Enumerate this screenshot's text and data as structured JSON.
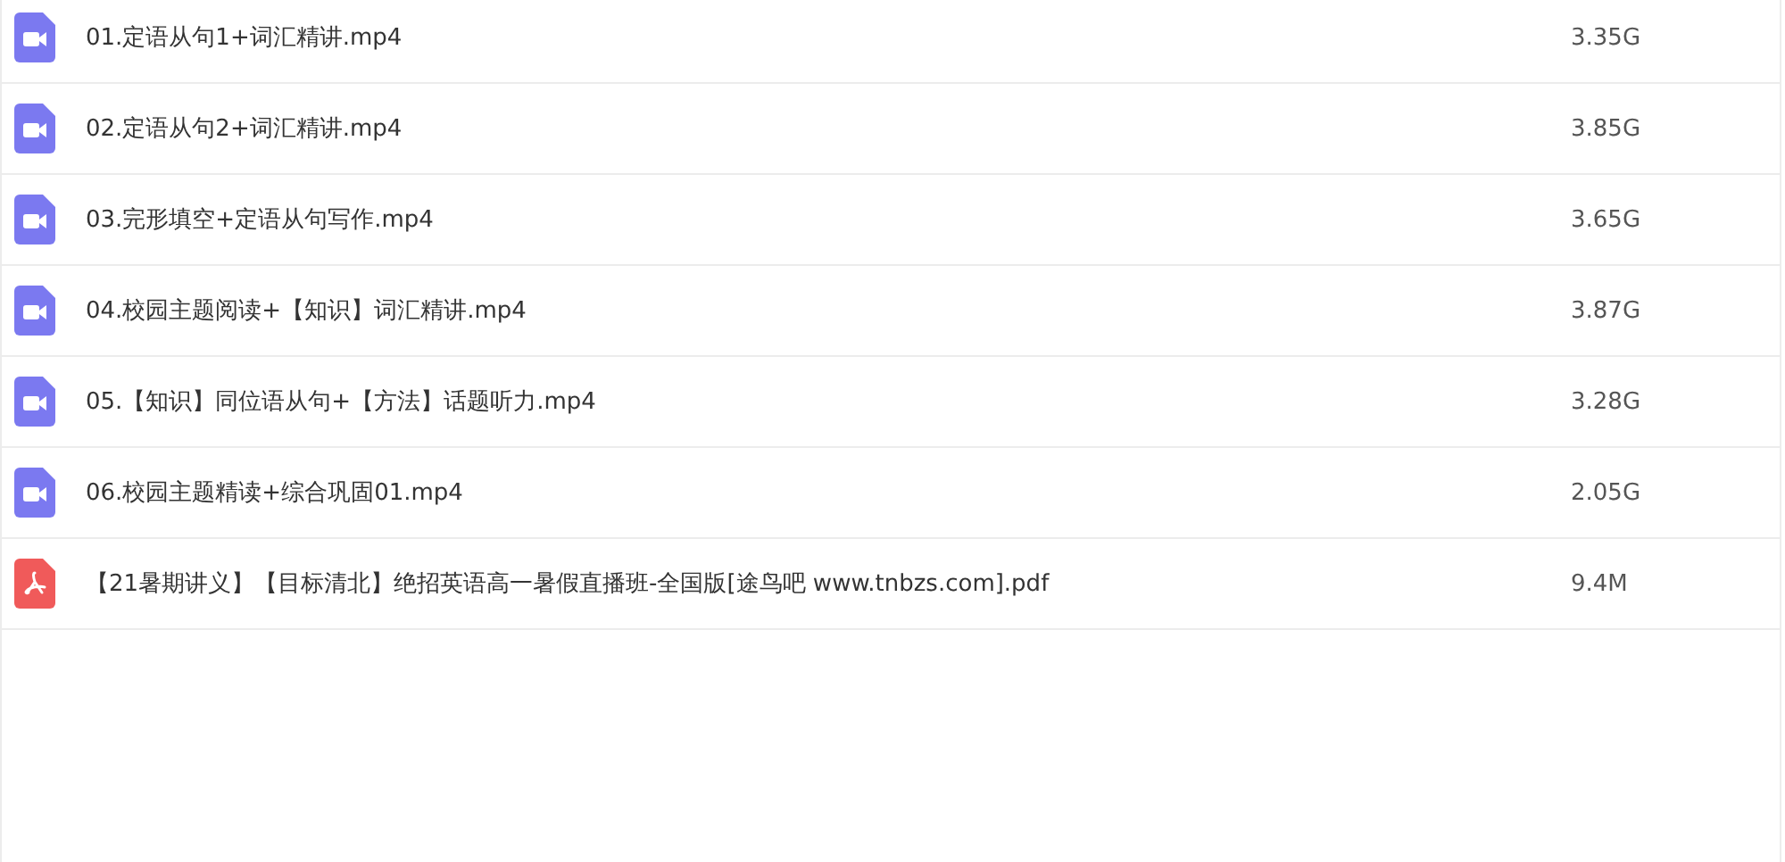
{
  "files": [
    {
      "kind": "video",
      "name": "01.定语从句1+词汇精讲.mp4",
      "size": "3.35G"
    },
    {
      "kind": "video",
      "name": "02.定语从句2+词汇精讲.mp4",
      "size": "3.85G"
    },
    {
      "kind": "video",
      "name": "03.完形填空+定语从句写作.mp4",
      "size": "3.65G"
    },
    {
      "kind": "video",
      "name": "04.校园主题阅读+【知识】词汇精讲.mp4",
      "size": "3.87G"
    },
    {
      "kind": "video",
      "name": "05.【知识】同位语从句+【方法】话题听力.mp4",
      "size": "3.28G"
    },
    {
      "kind": "video",
      "name": "06.校园主题精读+综合巩固01.mp4",
      "size": "2.05G"
    },
    {
      "kind": "pdf",
      "name": "【21暑期讲义】【目标清北】绝招英语高一暑假直播班-全国版[途鸟吧 www.tnbzs.com].pdf",
      "size": "9.4M"
    }
  ]
}
